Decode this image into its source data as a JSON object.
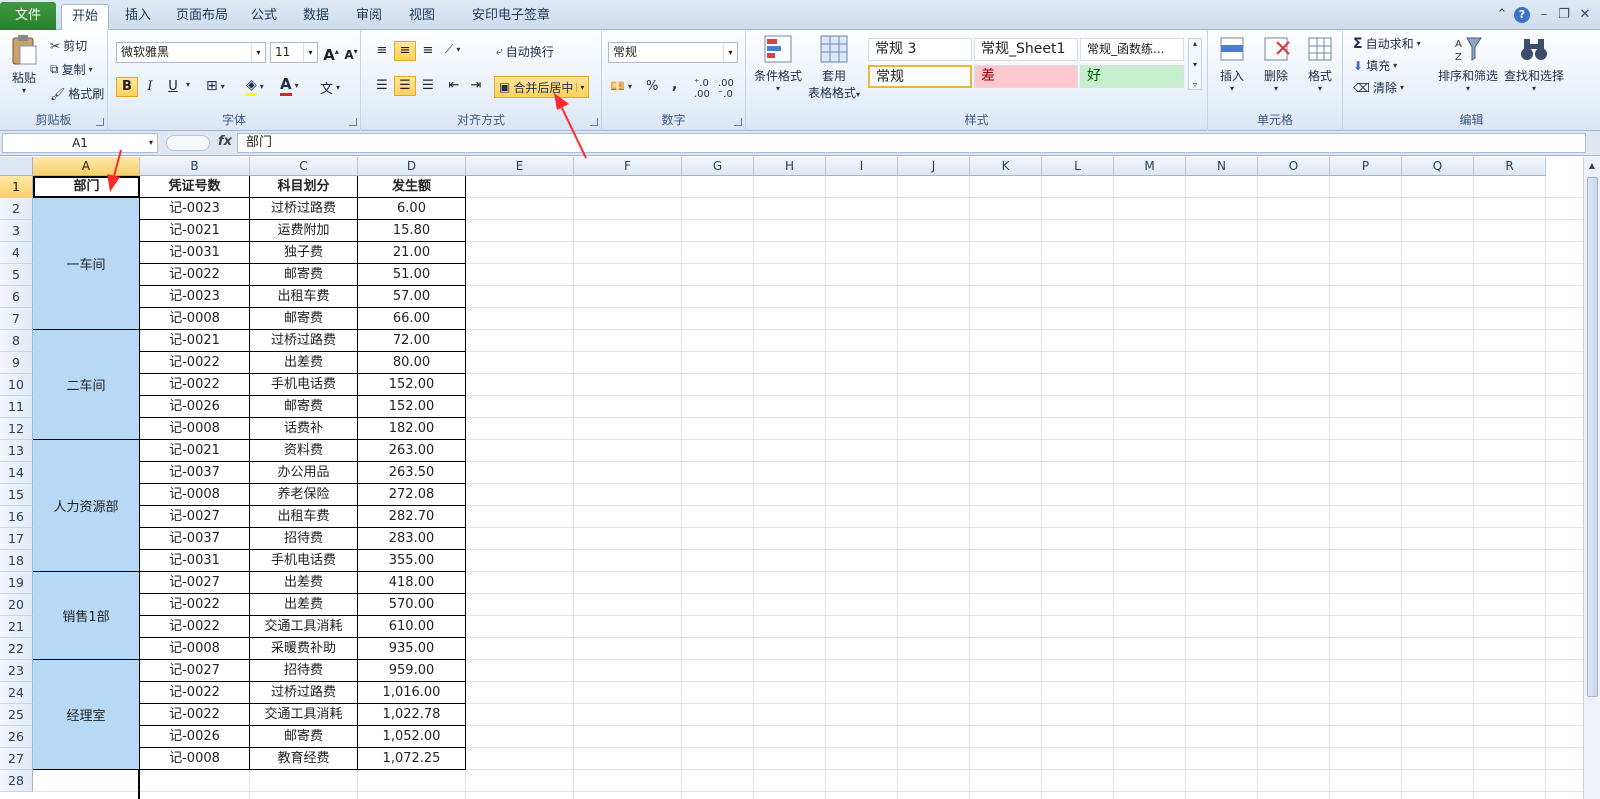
{
  "tabs": [
    "文件",
    "开始",
    "插入",
    "页面布局",
    "公式",
    "数据",
    "审阅",
    "视图",
    "安印电子签章"
  ],
  "active_tab": "开始",
  "ribbon": {
    "clipboard": {
      "paste": "粘贴",
      "cut": "剪切",
      "copy": "复制",
      "format_painter": "格式刷",
      "label": "剪贴板"
    },
    "font": {
      "name": "微软雅黑",
      "size": "11",
      "bold": "B",
      "italic": "I",
      "underline": "U",
      "label": "字体"
    },
    "alignment": {
      "wrap": "自动换行",
      "merge": "合并后居中",
      "label": "对齐方式"
    },
    "number": {
      "format": "常规",
      "percent": "%",
      "comma": ",",
      "label": "数字"
    },
    "styles": {
      "cond_format": "条件格式",
      "table_format_1": "套用",
      "table_format_2": "表格格式",
      "s1": "常规 3",
      "s2": "常规_Sheet1",
      "s3": "常规_函数练...",
      "s4": "常规",
      "s5": "差",
      "s6": "好",
      "label": "样式"
    },
    "cells": {
      "insert": "插入",
      "delete": "删除",
      "format": "格式",
      "label": "单元格"
    },
    "editing": {
      "autosum": "自动求和",
      "fill": "填充",
      "clear": "清除",
      "sort": "排序和筛选",
      "find": "查找和选择",
      "label": "编辑"
    }
  },
  "formula_bar": {
    "name_box": "A1",
    "fx": "fx",
    "content": "部门"
  },
  "columns": [
    "A",
    "B",
    "C",
    "D",
    "E",
    "F",
    "G",
    "H",
    "I",
    "J",
    "K",
    "L",
    "M",
    "N",
    "O",
    "P",
    "Q",
    "R"
  ],
  "rows": [
    "1",
    "2",
    "3",
    "4",
    "5",
    "6",
    "7",
    "8",
    "9",
    "10",
    "11",
    "12",
    "13",
    "14",
    "15",
    "16",
    "17",
    "18",
    "19",
    "20",
    "21",
    "22",
    "23",
    "24",
    "25",
    "26",
    "27",
    "28"
  ],
  "headers": {
    "a": "部门",
    "b": "凭证号数",
    "c": "科目划分",
    "d": "发生额"
  },
  "departments": [
    {
      "name": "一车间",
      "rows": 6
    },
    {
      "name": "二车间",
      "rows": 5
    },
    {
      "name": "人力资源部",
      "rows": 6
    },
    {
      "name": "销售1部",
      "rows": 4
    },
    {
      "name": "经理室",
      "rows": 5
    }
  ],
  "records": [
    [
      "记-0023",
      "过桥过路费",
      "6.00"
    ],
    [
      "记-0021",
      "运费附加",
      "15.80"
    ],
    [
      "记-0031",
      "独子费",
      "21.00"
    ],
    [
      "记-0022",
      "邮寄费",
      "51.00"
    ],
    [
      "记-0023",
      "出租车费",
      "57.00"
    ],
    [
      "记-0008",
      "邮寄费",
      "66.00"
    ],
    [
      "记-0021",
      "过桥过路费",
      "72.00"
    ],
    [
      "记-0022",
      "出差费",
      "80.00"
    ],
    [
      "记-0022",
      "手机电话费",
      "152.00"
    ],
    [
      "记-0026",
      "邮寄费",
      "152.00"
    ],
    [
      "记-0008",
      "话费补",
      "182.00"
    ],
    [
      "记-0021",
      "资料费",
      "263.00"
    ],
    [
      "记-0037",
      "办公用品",
      "263.50"
    ],
    [
      "记-0008",
      "养老保险",
      "272.08"
    ],
    [
      "记-0027",
      "出租车费",
      "282.70"
    ],
    [
      "记-0037",
      "招待费",
      "283.00"
    ],
    [
      "记-0031",
      "手机电话费",
      "355.00"
    ],
    [
      "记-0027",
      "出差费",
      "418.00"
    ],
    [
      "记-0022",
      "出差费",
      "570.00"
    ],
    [
      "记-0022",
      "交通工具消耗",
      "610.00"
    ],
    [
      "记-0008",
      "采暖费补助",
      "935.00"
    ],
    [
      "记-0027",
      "招待费",
      "959.00"
    ],
    [
      "记-0022",
      "过桥过路费",
      "1,016.00"
    ],
    [
      "记-0022",
      "交通工具消耗",
      "1,022.78"
    ],
    [
      "记-0026",
      "邮寄费",
      "1,052.00"
    ],
    [
      "记-0008",
      "教育经费",
      "1,072.25"
    ]
  ],
  "colors": {
    "accent": "#2a7e2e",
    "merged_fill": "#b8d9f5",
    "highlight": "#ffd15a",
    "arrow": "#ff2a2a",
    "bad_fill": "#ffc7ce",
    "good_fill": "#c6efce"
  }
}
